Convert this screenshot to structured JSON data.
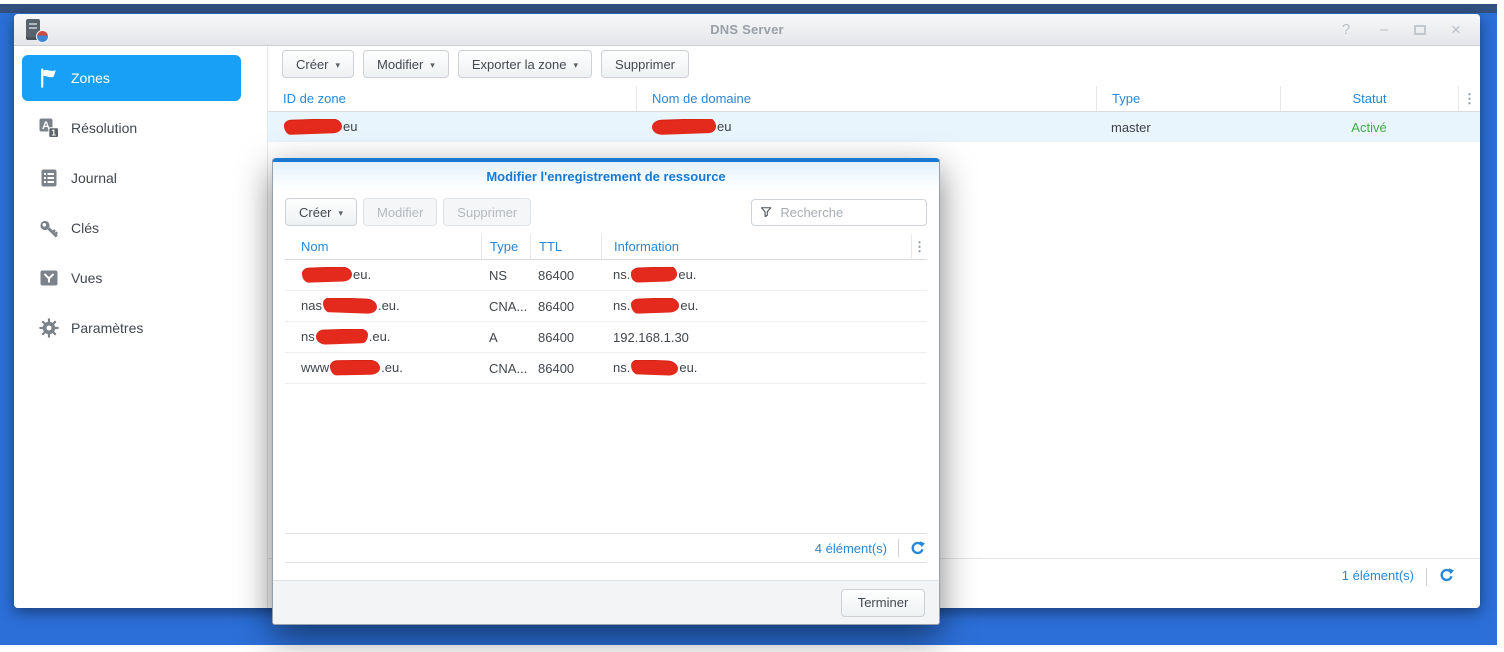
{
  "window": {
    "title": "DNS Server",
    "controls": {
      "help": "?",
      "minimize": "–",
      "close": "×"
    }
  },
  "sidebar": {
    "items": [
      {
        "label": "Zones",
        "icon": "flag-icon",
        "selected": true
      },
      {
        "label": "Résolution",
        "icon": "resolution-icon",
        "selected": false
      },
      {
        "label": "Journal",
        "icon": "journal-icon",
        "selected": false
      },
      {
        "label": "Clés",
        "icon": "key-icon",
        "selected": false
      },
      {
        "label": "Vues",
        "icon": "views-icon",
        "selected": false
      },
      {
        "label": "Paramètres",
        "icon": "gear-icon",
        "selected": false
      }
    ]
  },
  "zones_panel": {
    "toolbar": {
      "create_label": "Créer",
      "modify_label": "Modifier",
      "export_label": "Exporter la zone",
      "delete_label": "Supprimer"
    },
    "table": {
      "headers": {
        "zone_id": "ID de zone",
        "domain": "Nom de domaine",
        "type": "Type",
        "status": "Statut"
      },
      "rows": [
        {
          "zone_id_visible": "eu",
          "domain_visible": "eu",
          "type": "master",
          "status": "Activé",
          "redacted": true
        }
      ]
    },
    "status_bar": {
      "count": "1 élément(s)"
    }
  },
  "dialog": {
    "title": "Modifier l'enregistrement de ressource",
    "toolbar": {
      "create_label": "Créer",
      "modify_label": "Modifier",
      "delete_label": "Supprimer",
      "search_placeholder": "Recherche"
    },
    "table": {
      "headers": {
        "name": "Nom",
        "type": "Type",
        "ttl": "TTL",
        "info": "Information"
      },
      "rows": [
        {
          "name_prefix": "",
          "name_suffix": "eu.",
          "type": "NS",
          "ttl": "86400",
          "info_prefix": "ns.",
          "info_suffix": "eu.",
          "redacted": true
        },
        {
          "name_prefix": "nas",
          "name_suffix": ".eu.",
          "type": "CNA...",
          "ttl": "86400",
          "info_prefix": "ns.",
          "info_suffix": "eu.",
          "redacted": true
        },
        {
          "name_prefix": "ns",
          "name_suffix": ".eu.",
          "type": "A",
          "ttl": "86400",
          "info_value": "192.168.1.30",
          "redacted": true
        },
        {
          "name_prefix": "www",
          "name_suffix": ".eu.",
          "type": "CNA...",
          "ttl": "86400",
          "info_prefix": "ns.",
          "info_suffix": "eu.",
          "redacted": true
        }
      ]
    },
    "status_bar": {
      "count": "4 élément(s)"
    },
    "footer": {
      "done_label": "Terminer"
    }
  },
  "icons": {
    "more": "⋮",
    "caret": "▾"
  },
  "colors": {
    "accent_blue": "#2787d8",
    "dialog_blue": "#1779d2",
    "selected_blue": "#18a0f6",
    "status_green": "#3fae3f",
    "desktop_blue": "#2c6fd8",
    "redaction_red": "#e42a1d"
  }
}
